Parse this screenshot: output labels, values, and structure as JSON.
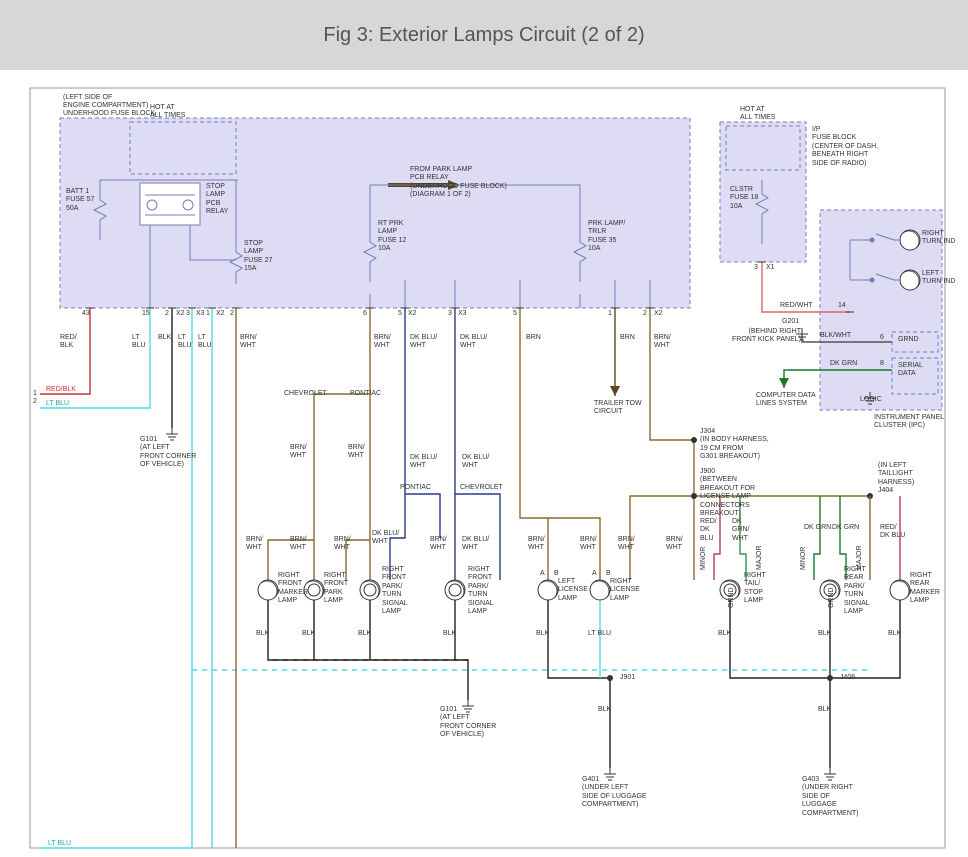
{
  "title": "Fig 3: Exterior Lamps Circuit (2 of 2)",
  "blocks": {
    "underhood": {
      "loc": "(LEFT SIDE OF\nENGINE COMPARTMENT)",
      "name": "UNDERHOOD FUSE BLOCK",
      "hot": "HOT AT\nALL TIMES",
      "batt_fuse": "BATT 1\nFUSE 57\n50A",
      "stop_relay": "STOP\nLAMP\nPCB\nRELAY",
      "stop_fuse": "STOP\nLAMP\nFUSE 27\n15A",
      "from_park": "FROM PARK LAMP\nPCB RELAY\n(UNDERHOOD FUSE BLOCK)\n(DIAGRAM 1 OF 2)",
      "rtprk_fuse": "RT PRK\nLAMP\nFUSE 12\n10A",
      "prklamp_fuse": "PRK LAMP/\nTRLR\nFUSE 35\n10A",
      "pins": {
        "p43": "43",
        "p15": "15",
        "p2a": "2",
        "p3a": "3",
        "p1a": "1",
        "p2b": "2",
        "p6": "6",
        "p5a": "5",
        "p3b": "3",
        "p5b": "5",
        "p1b": "1",
        "p2c": "2"
      },
      "conn": {
        "x2": "X2",
        "x3": "X3"
      },
      "pair_left": "1\n2"
    },
    "ip_fuse": {
      "hot": "HOT AT\nALL TIMES",
      "name": "I/P\nFUSE BLOCK\n(CENTER OF DASH,\nBENEATH RIGHT\nSIDE OF RADIO)",
      "clstr": "CLSTR\nFUSE 18\n10A",
      "pin3": "3",
      "x1": "X1"
    },
    "ipc": {
      "name": "INSTRUMENT PANEL\nCLUSTER (IPC)",
      "right_turn": "RIGHT\nTURN IND",
      "left_turn": "LEFT\nTURN IND",
      "grnd": "GRND",
      "serial": "SERIAL\nDATA",
      "logic": "LOGIC",
      "pin14": "14",
      "pin6": "6",
      "pin8": "8"
    }
  },
  "mid": {
    "g201": "G201",
    "g201_loc": "(BEHIND RIGHT\nFRONT KICK PANEL)",
    "cdl": "COMPUTER DATA\nLINES SYSTEM",
    "trailer": "TRAILER TOW\nCIRCUIT",
    "chevrolet": "CHEVROLET",
    "pontiac": "PONTIAC",
    "j304": "J304\n(IN BODY HARNESS,\n19 CM FROM\nG301 BREAKOUT)",
    "j900": "J900\n(BETWEEN\nBREAKOUT FOR\nLICENSE LAMP\nCONNECTORS\nBREAKOUT)",
    "j404": "(IN LEFT\nTAILLIGHT\nHARNESS)\nJ404",
    "j901": "J901",
    "j406": "J406",
    "g101": "G101\n(AT LEFT\nFRONT CORNER\nOF VEHICLE)",
    "g101b": "G101\n(AT LEFT\nFRONT CORNER\nOF VEHICLE)",
    "g401": "G401\n(UNDER LEFT\nSIDE OF LUGGAGE\nCOMPARTMENT)",
    "g403": "G403\n(UNDER RIGHT\nSIDE OF\nLUGGAGE\nCOMPARTMENT)"
  },
  "wire_labels": {
    "redblk": "RED/\nBLK",
    "ltblu": "LT\nBLU",
    "blk": "BLK",
    "brnwht": "BRN/\nWHT",
    "dkbluwht": "DK BLU/\nWHT",
    "brn": "BRN",
    "redwht": "RED/WHT",
    "blkwht": "BLK/WHT",
    "dkgrn": "DK GRN",
    "reddkblu": "RED/\nDK\nBLU",
    "dkgrnwht": "DK\nGRN/\nWHT",
    "reddkblu2": "RED/\nDK BLU",
    "minor": "MINOR",
    "major": "MAJOR",
    "grnd": "GRND",
    "redblk_h": "RED/BLK",
    "ltblu_h": "LT BLU",
    "ltblu_bot": "LT BLU",
    "a": "A",
    "b": "B"
  },
  "lamps": {
    "l1": "RIGHT\nFRONT\nMARKER\nLAMP",
    "l2": "RIGHT\nFRONT\nPARK\nLAMP",
    "l3": "RIGHT\nFRONT\nPARK/\nTURN\nSIGNAL\nLAMP",
    "l4": "RIGHT\nFRONT\nPARK/\nTURN\nSIGNAL\nLAMP",
    "l5": "LEFT\nLICENSE\nLAMP",
    "l6": "RIGHT\nLICENSE\nLAMP",
    "l7": "RIGHT\nTAIL/\nSTOP\nLAMP",
    "l8": "RIGHT\nREAR\nPARK/\nTURN\nSIGNAL\nLAMP",
    "l9": "RIGHT\nREAR\nMARKER\nLAMP"
  }
}
